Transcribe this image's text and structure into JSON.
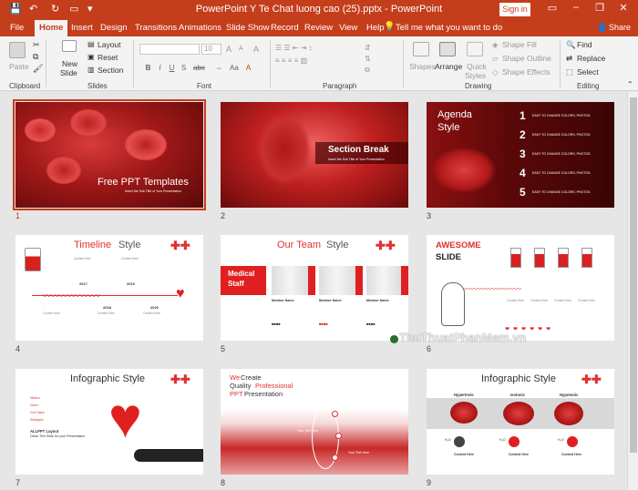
{
  "window": {
    "title": "PowerPoint Y Te Chat luong cao (25).pptx - PowerPoint",
    "signin": "Sign in",
    "minimize": "–",
    "restore": "❐",
    "close": "✕",
    "ribbon_options": "▭"
  },
  "quick_access": {
    "save": "💾",
    "undo": "↶",
    "redo": "↻",
    "start": "▭",
    "customize": "▾"
  },
  "tabs": [
    "File",
    "Home",
    "Insert",
    "Design",
    "Transitions",
    "Animations",
    "Slide Show",
    "Record",
    "Review",
    "View",
    "Help"
  ],
  "active_tab": "Home",
  "tell_me": "Tell me what you want to do",
  "share": "Share",
  "ribbon": {
    "clipboard": {
      "label": "Clipboard",
      "paste": "Paste"
    },
    "slides": {
      "label": "Slides",
      "new_slide": "New",
      "new_slide2": "Slide",
      "layout": "Layout",
      "reset": "Reset",
      "section": "Section"
    },
    "font": {
      "label": "Font",
      "size": "10",
      "bold": "B",
      "italic": "I",
      "underline": "U",
      "strike": "S",
      "grow": "A",
      "shrink": "A",
      "clear": "A"
    },
    "paragraph": {
      "label": "Paragraph"
    },
    "drawing": {
      "label": "Drawing",
      "shapes": "Shapes",
      "arrange": "Arrange",
      "quick_styles": "Quick",
      "quick_styles2": "Styles",
      "shape_fill": "Shape Fill",
      "shape_outline": "Shape Outline",
      "shape_effects": "Shape Effects"
    },
    "editing": {
      "label": "Editing",
      "find": "Find",
      "replace": "Replace",
      "select": "Select"
    }
  },
  "slides": [
    {
      "num": "1",
      "title": "Free PPT Templates",
      "subtitle": "Insert the Sub Title of Your Presentation"
    },
    {
      "num": "2",
      "title": "Section Break",
      "subtitle": "Insert the Sub Title of Your Presentation"
    },
    {
      "num": "3",
      "title": "Agenda",
      "title2": "Style",
      "items": [
        "1",
        "2",
        "3",
        "4",
        "5"
      ],
      "item_text": "EASY TO CHANGE COLORS, PHOTOS."
    },
    {
      "num": "4",
      "title_a": "Timeline",
      "title_b": " Style",
      "years": [
        "2017",
        "2018",
        "2019",
        "2020"
      ],
      "label": "Content Here"
    },
    {
      "num": "5",
      "title_a": "Our Team",
      "title_b": " Style",
      "banner": "Medical",
      "banner2": "Staff",
      "member": "Member Name"
    },
    {
      "num": "6",
      "title": "AWESOME",
      "title2": "SLIDE",
      "label": "Content Here"
    },
    {
      "num": "7",
      "title": "Infographic Style",
      "heading": "ALLPPT Layout",
      "heading2": "Clean Text Slide for your Presentation",
      "rows": [
        "Mission",
        "Vision",
        "Core Value",
        "Strategies"
      ]
    },
    {
      "num": "8",
      "l1a": "We ",
      "l1b": "Create",
      "l2a": "Quality ",
      "l2b": "Professional",
      "l3a": "PPT ",
      "l3b": "Presentation",
      "label": "Your Text Here"
    },
    {
      "num": "9",
      "title": "Infographic Style",
      "cols": [
        "Hypertonic",
        "Isotonic",
        "Hypotonic"
      ],
      "h2o": "H₂O",
      "content": "Content Here"
    }
  ],
  "watermark": "ThuThuatPhanMem.vn",
  "colors": {
    "accent": "#c43e1c",
    "slide_red": "#e03030"
  }
}
